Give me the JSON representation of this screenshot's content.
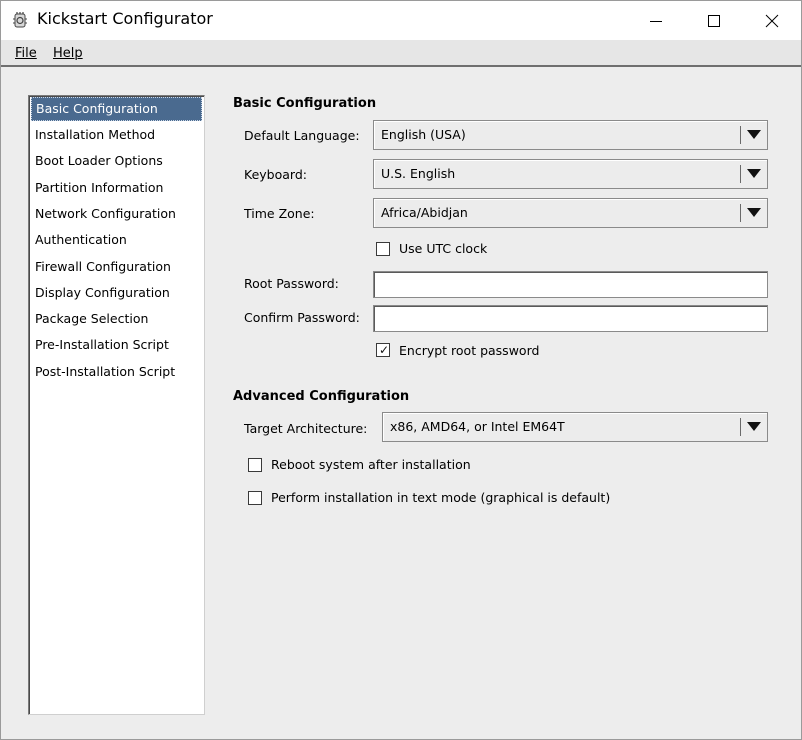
{
  "window": {
    "title": "Kickstart Configurator",
    "icon": "kickstart-app-icon",
    "controls": [
      "minimize-icon",
      "maximize-icon",
      "close-icon"
    ]
  },
  "menubar": {
    "file": "File",
    "help": "Help"
  },
  "sidebar": {
    "selected": "Basic Configuration",
    "items": [
      "Basic Configuration",
      "Installation Method",
      "Boot Loader Options",
      "Partition Information",
      "Network Configuration",
      "Authentication",
      "Firewall Configuration",
      "Display Configuration",
      "Package Selection",
      "Pre-Installation Script",
      "Post-Installation Script"
    ]
  },
  "basic": {
    "section_title": "Basic Configuration",
    "language_label": "Default Language:",
    "language_value": "English (USA)",
    "keyboard_label": "Keyboard:",
    "keyboard_value": "U.S. English",
    "timezone_label": "Time Zone:",
    "timezone_value": "Africa/Abidjan",
    "utc_label": "Use UTC clock",
    "utc_checked": false,
    "root_password_label": "Root Password:",
    "root_password_value": "",
    "confirm_password_label": "Confirm Password:",
    "confirm_password_value": "",
    "encrypt_label": "Encrypt root password",
    "encrypt_checked": true
  },
  "advanced": {
    "section_title": "Advanced Configuration",
    "arch_label": "Target Architecture:",
    "arch_value": "x86, AMD64, or Intel EM64T",
    "reboot_label": "Reboot system after installation",
    "reboot_checked": false,
    "textmode_label": "Perform installation in text mode (graphical is default)",
    "textmode_checked": false
  },
  "colors": {
    "selection": "#4a6a8f",
    "background": "#ededed"
  }
}
